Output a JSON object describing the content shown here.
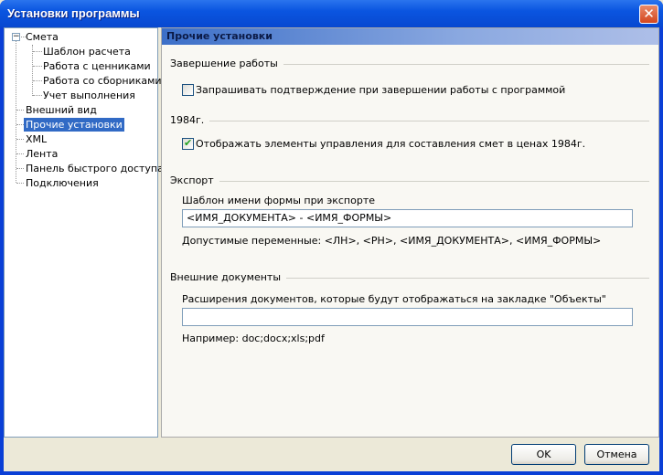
{
  "window": {
    "title": "Установки программы",
    "close_icon": "close-icon"
  },
  "tree": {
    "items": [
      {
        "label": "Смета",
        "level": 0,
        "expanded": true
      },
      {
        "label": "Шаблон расчета",
        "level": 1
      },
      {
        "label": "Работа с ценниками",
        "level": 1
      },
      {
        "label": "Работа со сборниками",
        "level": 1
      },
      {
        "label": "Учет выполнения",
        "level": 1
      },
      {
        "label": "Внешний вид",
        "level": 0
      },
      {
        "label": "Прочие установки",
        "level": 0,
        "selected": true
      },
      {
        "label": "XML",
        "level": 0
      },
      {
        "label": "Лента",
        "level": 0
      },
      {
        "label": "Панель быстрого доступа",
        "level": 0
      },
      {
        "label": "Подключения",
        "level": 0
      }
    ]
  },
  "panel": {
    "header": "Прочие установки",
    "shutdown": {
      "title": "Завершение работы",
      "confirm_label": "Запрашивать подтверждение при завершении работы с программой",
      "confirm_checked": false
    },
    "y1984": {
      "title": "1984г.",
      "show_label": "Отображать элементы управления для составления смет в ценах 1984г.",
      "show_checked": true
    },
    "export": {
      "title": "Экспорт",
      "template_label": "Шаблон имени формы при экспорте",
      "template_value": "<ИМЯ_ДОКУМЕНТА> - <ИМЯ_ФОРМЫ>",
      "vars_hint": "Допустимые переменные: <ЛН>, <РН>, <ИМЯ_ДОКУМЕНТА>, <ИМЯ_ФОРМЫ>"
    },
    "external": {
      "title": "Внешние документы",
      "ext_label": "Расширения документов, которые будут отображаться на закладке \"Объекты\"",
      "ext_value": "",
      "example": "Например: doc;docx;xls;pdf"
    }
  },
  "buttons": {
    "ok": "OK",
    "cancel": "Отмена"
  }
}
